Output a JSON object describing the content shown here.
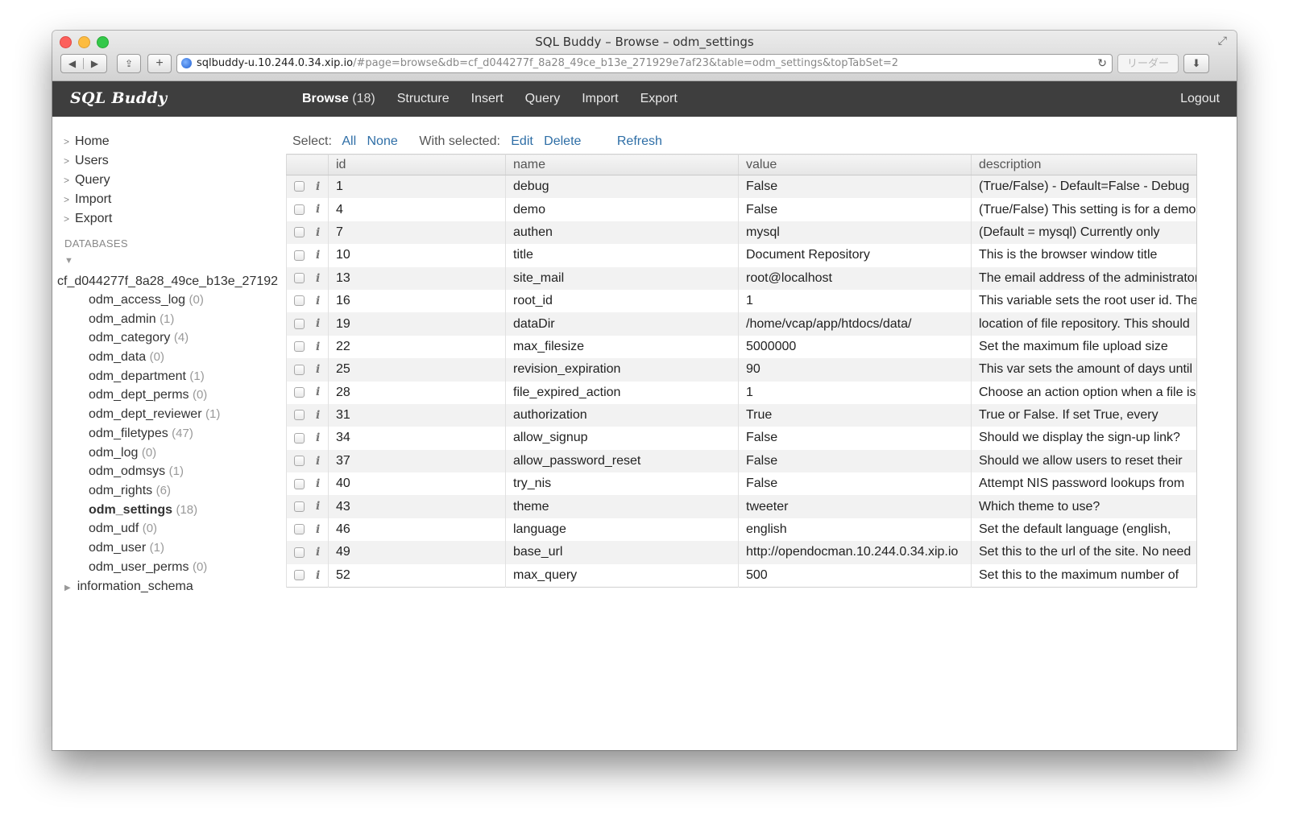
{
  "window": {
    "title": "SQL Buddy – Browse – odm_settings",
    "url_host": "sqlbuddy-u.10.244.0.34.xip.io",
    "url_rest": "/#page=browse&db=cf_d044277f_8a28_49ce_b13e_271929e7af23&table=odm_settings&topTabSet=2",
    "reader_label": "リーダー"
  },
  "header": {
    "logo": "SQL Buddy",
    "tabs": [
      {
        "label": "Browse",
        "count": "(18)"
      },
      {
        "label": "Structure"
      },
      {
        "label": "Insert"
      },
      {
        "label": "Query"
      },
      {
        "label": "Import"
      },
      {
        "label": "Export"
      }
    ],
    "logout": "Logout"
  },
  "sidebar": {
    "nav": [
      "Home",
      "Users",
      "Query",
      "Import",
      "Export"
    ],
    "databases_heading": "DATABASES",
    "db_name": "cf_d044277f_8a28_49ce_b13e_27192",
    "tables": [
      {
        "name": "odm_access_log",
        "count": "(0)"
      },
      {
        "name": "odm_admin",
        "count": "(1)"
      },
      {
        "name": "odm_category",
        "count": "(4)"
      },
      {
        "name": "odm_data",
        "count": "(0)"
      },
      {
        "name": "odm_department",
        "count": "(1)"
      },
      {
        "name": "odm_dept_perms",
        "count": "(0)"
      },
      {
        "name": "odm_dept_reviewer",
        "count": "(1)"
      },
      {
        "name": "odm_filetypes",
        "count": "(47)"
      },
      {
        "name": "odm_log",
        "count": "(0)"
      },
      {
        "name": "odm_odmsys",
        "count": "(1)"
      },
      {
        "name": "odm_rights",
        "count": "(6)"
      },
      {
        "name": "odm_settings",
        "count": "(18)"
      },
      {
        "name": "odm_udf",
        "count": "(0)"
      },
      {
        "name": "odm_user",
        "count": "(1)"
      },
      {
        "name": "odm_user_perms",
        "count": "(0)"
      }
    ],
    "selected_table": "odm_settings",
    "other_db": "information_schema"
  },
  "actions": {
    "select_label": "Select:",
    "all": "All",
    "none": "None",
    "with_selected_label": "With selected:",
    "edit": "Edit",
    "delete": "Delete",
    "refresh": "Refresh"
  },
  "table": {
    "columns": [
      "id",
      "name",
      "value",
      "description"
    ],
    "rows": [
      [
        "1",
        "debug",
        "False",
        "(True/False) - Default=False - Debug"
      ],
      [
        "4",
        "demo",
        "False",
        "(True/False) This setting is for a demo"
      ],
      [
        "7",
        "authen",
        "mysql",
        "(Default = mysql) Currently only"
      ],
      [
        "10",
        "title",
        "Document Repository",
        "This is the browser window title"
      ],
      [
        "13",
        "site_mail",
        "root@localhost",
        "The email address of the administrator"
      ],
      [
        "16",
        "root_id",
        "1",
        "This variable sets the root user id. The"
      ],
      [
        "19",
        "dataDir",
        "/home/vcap/app/htdocs/data/",
        "location of file repository. This should"
      ],
      [
        "22",
        "max_filesize",
        "5000000",
        "Set the maximum file upload size"
      ],
      [
        "25",
        "revision_expiration",
        "90",
        "This var sets the amount of days until"
      ],
      [
        "28",
        "file_expired_action",
        "1",
        "Choose an action option when a file is"
      ],
      [
        "31",
        "authorization",
        "True",
        "True or False. If set True, every"
      ],
      [
        "34",
        "allow_signup",
        "False",
        "Should we display the sign-up link?"
      ],
      [
        "37",
        "allow_password_reset",
        "False",
        "Should we allow users to reset their"
      ],
      [
        "40",
        "try_nis",
        "False",
        "Attempt NIS password lookups from"
      ],
      [
        "43",
        "theme",
        "tweeter",
        "Which theme to use?"
      ],
      [
        "46",
        "language",
        "english",
        "Set the default language (english,"
      ],
      [
        "49",
        "base_url",
        "http://opendocman.10.244.0.34.xip.io",
        "Set this to the url of the site. No need"
      ],
      [
        "52",
        "max_query",
        "500",
        "Set this to the maximum number of"
      ]
    ]
  },
  "colors": {
    "header_bg": "#3e3e3e",
    "link": "#2e6ea6",
    "row_alt": "#f2f2f2"
  }
}
